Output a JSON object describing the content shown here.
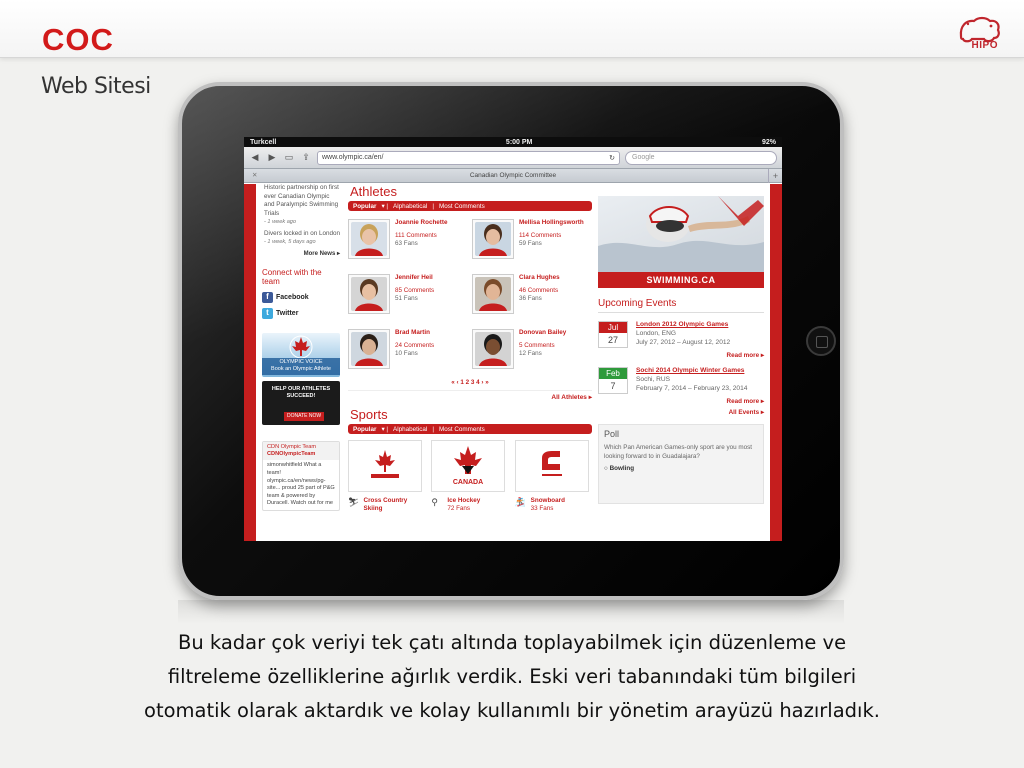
{
  "slide": {
    "brand": "COC",
    "subtitle": "Web Sitesi",
    "logo_label": "HIPO",
    "caption": [
      "Bu kadar çok veriyi tek çatı altında toplayabilmek için düzenleme ve",
      "filtreleme özelliklerine ağırlık verdik. Eski veri tabanındaki tüm bilgileri",
      "otomatik olarak aktardık ve kolay kullanımlı bir yönetim arayüzü hazırladık."
    ]
  },
  "device": {
    "status": {
      "carrier": "Turkcell",
      "time": "5:00 PM",
      "battery": "92%"
    },
    "browser": {
      "url": "www.olympic.ca/en/",
      "search_placeholder": "Google",
      "tab_title": "Canadian Olympic Committee"
    }
  },
  "site": {
    "left": {
      "news": [
        {
          "text": "Historic partnership on first ever Canadian Olympic and Paralympic Swimming Trials",
          "time": "- 1 week ago"
        },
        {
          "text": "Divers locked in on London",
          "time": "- 1 week, 5 days ago"
        }
      ],
      "more_news": "More News",
      "connect": "Connect with the team",
      "social": [
        {
          "label": "Facebook",
          "icon": "facebook-icon",
          "color": "#3b5998",
          "glyph": "f"
        },
        {
          "label": "Twitter",
          "icon": "twitter-icon",
          "color": "#3ea9dd",
          "glyph": "t"
        }
      ],
      "promo1": "Book an Olympic Athlete",
      "promo1_sub": "OLYMPIC VOICE",
      "promo2": "HELP OUR ATHLETES SUCCEED!",
      "promo2_cta": "DONATE NOW",
      "twitter_box": {
        "header1": "CDN Olympic Team",
        "header2": "CDNOlympicTeam",
        "body": "simonwhitfield What a team! olympic.ca/en/news/pg-site... proud 25 part of P&G team & powered by Duracell. Watch out for me"
      }
    },
    "athletes": {
      "title": "Athletes",
      "filters": [
        "Popular",
        "Alphabetical",
        "Most Comments"
      ],
      "items": [
        {
          "name": "Joannie Rochette",
          "comments": "111 Comments",
          "fans": "63 Fans",
          "skin": "#e9c3a8",
          "hair": "#c8a25a",
          "bg": "#d7dfe8"
        },
        {
          "name": "Mellisa Hollingsworth",
          "comments": "114 Comments",
          "fans": "59 Fans",
          "skin": "#e5bca0",
          "hair": "#4a2f1e",
          "bg": "#c9d6e2"
        },
        {
          "name": "Jennifer Heil",
          "comments": "85 Comments",
          "fans": "51 Fans",
          "skin": "#e8c0a2",
          "hair": "#5a3a22",
          "bg": "#d5d5d5"
        },
        {
          "name": "Clara Hughes",
          "comments": "46 Comments",
          "fans": "36 Fans",
          "skin": "#e1b596",
          "hair": "#7a4b2a",
          "bg": "#c9c3b9"
        },
        {
          "name": "Brad Martin",
          "comments": "24 Comments",
          "fans": "10 Fans",
          "skin": "#d9b193",
          "hair": "#2a1f18",
          "bg": "#cfd7df"
        },
        {
          "name": "Donovan Bailey",
          "comments": "5 Comments",
          "fans": "12 Fans",
          "skin": "#7a4e32",
          "hair": "#1a1a1a",
          "bg": "#d3d3d3"
        }
      ],
      "pager": "« ‹ 1 2 3 4 › »",
      "all_link": "All Athletes"
    },
    "sports": {
      "title": "Sports",
      "filters": [
        "Popular",
        "Alphabetical",
        "Most Comments"
      ],
      "items": [
        {
          "name": "Cross Country Skiing",
          "fans": "",
          "icon": "skier-icon"
        },
        {
          "name": "Ice Hockey",
          "fans": "72 Fans",
          "icon": "hockey-icon"
        },
        {
          "name": "Snowboard",
          "fans": "33 Fans",
          "icon": "snowboard-icon"
        }
      ],
      "logo_text": {
        "hockey": "CANADA"
      }
    },
    "right": {
      "swim_label": "SWIMMING.CA",
      "events_title": "Upcoming Events",
      "events": [
        {
          "month": "Jul",
          "day": "27",
          "color": "#c51e1e",
          "name": "London 2012 Olympic Games",
          "loc": "London, ENG",
          "dates": "July 27, 2012 – August 12, 2012",
          "more": "Read more"
        },
        {
          "month": "Feb",
          "day": "7",
          "color": "#2e9a3b",
          "name": "Sochi 2014 Olympic Winter Games",
          "loc": "Sochi, RUS",
          "dates": "February 7, 2014 – February 23, 2014",
          "more": "Read more"
        }
      ],
      "all_events": "All Events",
      "poll": {
        "title": "Poll",
        "question": "Which Pan American Games-only sport are you most looking forward to in Guadalajara?",
        "option": "Bowling"
      }
    }
  }
}
